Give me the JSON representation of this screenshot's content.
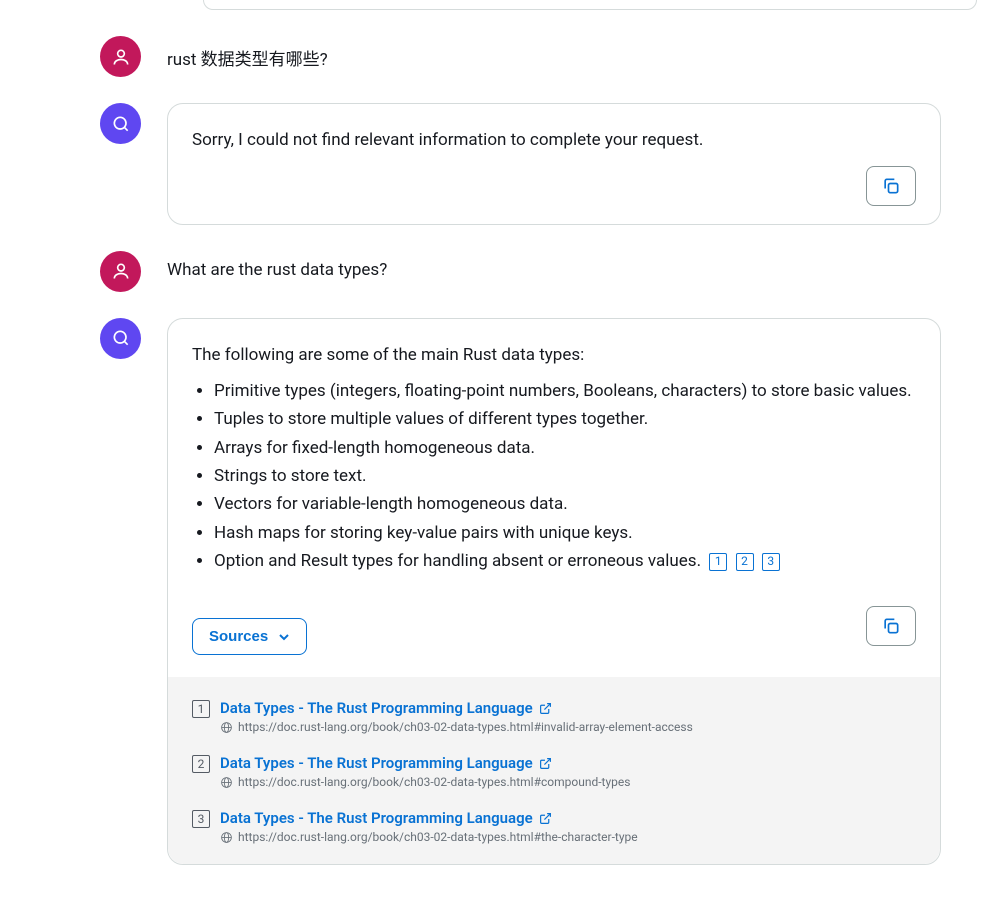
{
  "messages": [
    {
      "role": "user",
      "text": "rust 数据类型有哪些?"
    },
    {
      "role": "bot",
      "text": "Sorry, I could not find relevant information to complete your request."
    },
    {
      "role": "user",
      "text": "What are the rust data types?"
    },
    {
      "role": "bot",
      "intro": "The following are some of the main Rust data types:",
      "bullets": [
        "Primitive types (integers, floating-point numbers, Booleans, characters) to store basic values.",
        "Tuples to store multiple values of different types together.",
        "Arrays for fixed-length homogeneous data.",
        "Strings to store text.",
        "Vectors for variable-length homogeneous data.",
        "Hash maps for storing key-value pairs with unique keys.",
        "Option and Result types for handling absent or erroneous values."
      ],
      "citations": [
        "1",
        "2",
        "3"
      ],
      "sources_label": "Sources",
      "sources": [
        {
          "num": "1",
          "title": "Data Types - The Rust Programming Language",
          "url": "https://doc.rust-lang.org/book/ch03-02-data-types.html#invalid-array-element-access"
        },
        {
          "num": "2",
          "title": "Data Types - The Rust Programming Language",
          "url": "https://doc.rust-lang.org/book/ch03-02-data-types.html#compound-types"
        },
        {
          "num": "3",
          "title": "Data Types - The Rust Programming Language",
          "url": "https://doc.rust-lang.org/book/ch03-02-data-types.html#the-character-type"
        }
      ]
    }
  ]
}
